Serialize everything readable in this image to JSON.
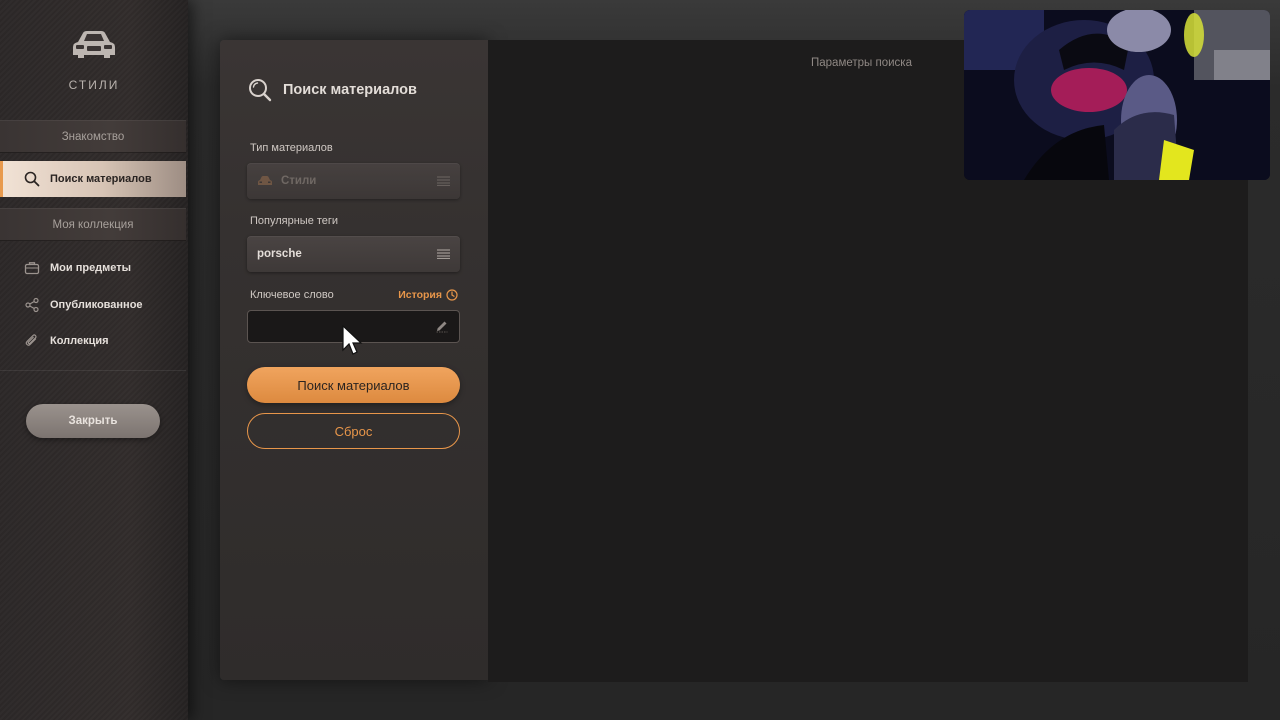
{
  "sidebar": {
    "brand": {
      "icon": "car-icon",
      "label": "СТИЛИ"
    },
    "sections": {
      "intro": "Знакомство",
      "collection": "Моя коллекция"
    },
    "items": {
      "search": {
        "label": "Поиск материалов",
        "icon": "search-icon",
        "active": true
      },
      "my_items": {
        "label": "Мои предметы",
        "icon": "briefcase-icon"
      },
      "published": {
        "label": "Опубликованное",
        "icon": "share-icon"
      },
      "collection": {
        "label": "Коллекция",
        "icon": "paperclip-icon"
      }
    },
    "close_label": "Закрыть"
  },
  "panel": {
    "title": "Поиск материалов",
    "title_icon": "search-icon",
    "material_type": {
      "label": "Тип материалов",
      "value": "Стили",
      "icon": "car-icon",
      "disabled": true
    },
    "popular_tags": {
      "label": "Популярные теги",
      "value": "porsche"
    },
    "keyword": {
      "label": "Ключевое слово",
      "value": "",
      "placeholder": "",
      "history_label": "История",
      "history_icon": "clock-icon"
    },
    "search_button": "Поиск материалов",
    "reset_button": "Сброс"
  },
  "results": {
    "header": "Параметры поиска"
  },
  "colors": {
    "accent": "#e8964a",
    "button_fill": "#e99a50",
    "panel_bg": "#353130",
    "results_bg": "#1d1c1c"
  }
}
